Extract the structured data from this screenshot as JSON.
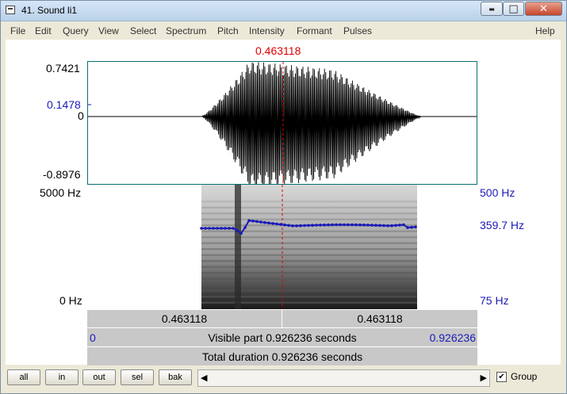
{
  "window": {
    "title": "41. Sound li1",
    "minimize": "▬",
    "maximize": "□",
    "close": "✕"
  },
  "menu": [
    "File",
    "Edit",
    "Query",
    "View",
    "Select",
    "Spectrum",
    "Pitch",
    "Intensity",
    "Formant",
    "Pulses",
    "Help"
  ],
  "cursor": {
    "time": "0.463118"
  },
  "waveform": {
    "max": "0.7421",
    "cursor_value": "0.1478",
    "zero": "0",
    "min": "-0.8976"
  },
  "spectrogram": {
    "freq_top": "5000 Hz",
    "freq_bottom": "0 Hz",
    "pitch_top": "500 Hz",
    "pitch_value": "359.7 Hz",
    "pitch_bottom": "75 Hz"
  },
  "time_bar": {
    "left": "0.463118",
    "right": "0.463118"
  },
  "visible_bar": {
    "start": "0",
    "label": "Visible part 0.926236 seconds",
    "end": "0.926236"
  },
  "total_bar": {
    "label": "Total duration 0.926236 seconds"
  },
  "buttons": {
    "all": "all",
    "in": "in",
    "out": "out",
    "sel": "sel",
    "bak": "bak"
  },
  "group": {
    "label": "Group",
    "checked": true
  }
}
